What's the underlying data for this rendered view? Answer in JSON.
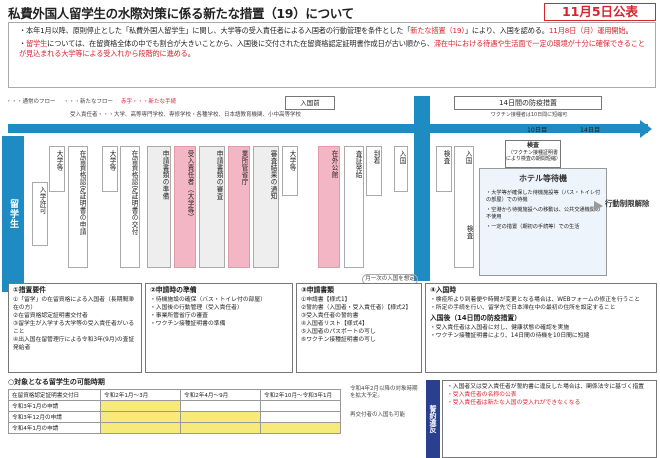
{
  "title": "私費外国人留学生の水際対策に係る新たな措置（19）について",
  "date_badge": "11月5日公表",
  "intro": {
    "p1_a": "本年1月以降、原則停止とした「私費外国人留学生」に関し、大学等の受入責任者による入国者の行動管理を条件とした「",
    "p1_b": "新たな措置（19）",
    "p1_c": "」により、入国を認める。",
    "p1_d": "11月8日（月）運用開始",
    "p1_e": "。",
    "p2_a": "留学生",
    "p2_b": "については、在留資格全体の中でも割合が大きいことから、入国後に交付された在留資格認定証明書作成日が古い順から、",
    "p2_c": "滞在中における待遇や生活面で一定の環境が十分に確保できることが見込まれる大学等による受入れから段階的に進める",
    "p2_d": "。"
  },
  "legend": {
    "flow": "・・・通常のフロー",
    "new_flow": "・・・新たなフロー",
    "red": "赤字・・・新たな手続"
  },
  "actors": "受入責任者・・・大学、高等専門学校、専修学校・各種学校、日本語教育機関、小中高等学校",
  "timeline": {
    "before_entry": "入国前",
    "days14": "14日間の防疫措置",
    "vaccine_note": "ワクチン接種者は10日間に短縮可",
    "day10": "10日目",
    "day14": "14日目",
    "check_title": "検査",
    "check_note": "（ワクチン接種証明書により検査の期間短縮）"
  },
  "columns": {
    "student": "留学生",
    "c1": "入学許可",
    "c2": "大学等",
    "c3": "在留資格認定証明書の申請",
    "c4": "大学等",
    "c5": "在留資格認定証明書の交付",
    "c6": "申請書類の準備",
    "c7": "受入責任者（大学等）",
    "c8": "申請書類の審査",
    "c9": "業所管省庁",
    "c10": "審査結果の通知",
    "c11": "大学等",
    "c12": "在外公館",
    "c13": "査証発給",
    "c14": "到着",
    "c15": "入国",
    "c16": "検査",
    "c17": "入国",
    "c18": "検査",
    "month_note": "月一次の入国を想定"
  },
  "hotel": {
    "title": "ホテル等待機",
    "items": [
      "・大学等が確保した待機施設等（バス・トイレ付の部屋）での待機",
      "・空港から待機施設への移動は、公共交通機関の不使用",
      "・一定の措置（期初の手続等）での生活"
    ]
  },
  "release": "行動制限解除",
  "boxes": {
    "reqs_title": "①措置要件",
    "reqs": [
      "①「留学」の在留資格による入国者（長期間滞在の方）",
      "②在留資格認定証明書交付者",
      "③留学生が入学する大学等の受入責任者がいること",
      "④出入国在留管理庁による令和3年(9月)の査証発給者"
    ],
    "prep_title": "②申請時の準備",
    "prep": [
      "・待機施設の確保（バス・トイレ付の部屋）",
      "・入国後の行動管理（受入責任者）",
      "・事業所管省庁の審査",
      "・ワクチン接種証明書の準備"
    ],
    "docs_title": "③申請書類",
    "docs": [
      "①申請書【様式1】",
      "②誓約書（入国者・受入責任者）【様式2】",
      "③受入責任者の誓約書",
      "④入国者リスト【様式4】",
      "⑤入国者のパスポートの写し",
      "⑥ワクチン接種証明書の写し"
    ],
    "entry_title": "④入国時",
    "entry": [
      "・検疫所より到着便や時間が変更となる場合は、WEBフォームの修正を行うこと",
      "・所定の手続を行い、留学先で日本滞在中の最初の住所を設定すること"
    ],
    "after_title": "入国後（14日間の防疫措置）",
    "after": [
      "・受入責任者は入国者に対し、健康状態の確認を実施",
      "・ワクチン接種証明書により、14日間の待機を10日間に短縮"
    ]
  },
  "table": {
    "title": "○対象となる留学生の可能時期",
    "headers": [
      "在留資格認定証明書交付日",
      "令和2年1月〜3月",
      "令和2年4月〜9月",
      "令和2年10月〜令和3年1月"
    ],
    "rows": [
      [
        "令和3年1月の申請",
        "",
        "",
        ""
      ],
      [
        "令和3年12月の申請",
        "",
        "",
        ""
      ],
      [
        "令和4年1月の申請",
        "",
        "",
        ""
      ]
    ],
    "side_note": "令和4年2月以降の対象時期を拡大予定。",
    "side_note2": "再交付者の入国も可能"
  },
  "violation": {
    "label": "誓約違反",
    "items": [
      "・入国者又は受入責任者が誓約書に違反した場合は、関係法令に基づく措置",
      "・受入責任者の名称の公表",
      "・受入責任者は新たな入国の受入れができなくなる"
    ]
  }
}
